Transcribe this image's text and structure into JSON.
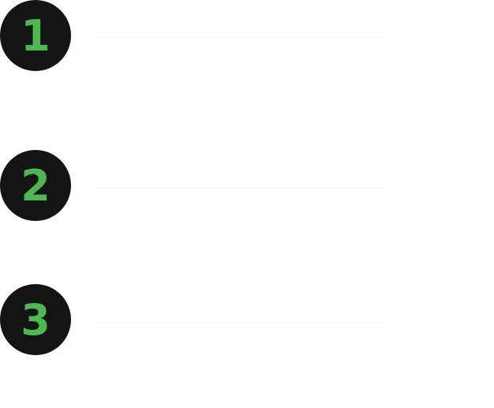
{
  "steps": [
    {
      "number": "1"
    },
    {
      "number": "2"
    },
    {
      "number": "3"
    }
  ],
  "colors": {
    "badge_background": "#141414",
    "badge_number": "#4cb84f",
    "divider": "#f1f1f1",
    "page_background": "#ffffff"
  }
}
